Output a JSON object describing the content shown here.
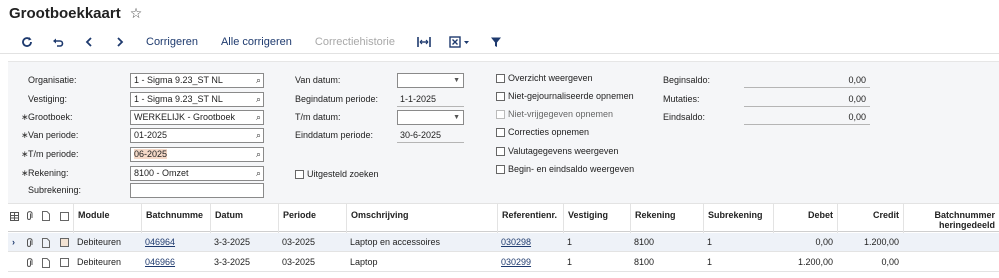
{
  "header": {
    "title": "Grootboekkaart",
    "star_icon": "star-icon"
  },
  "toolbar": {
    "corrigeren": "Corrigeren",
    "alle_corrigeren": "Alle corrigeren",
    "correctiehistorie": "Correctiehistorie"
  },
  "form": {
    "organisatie_label": "Organisatie:",
    "organisatie_value": "1 - Sigma 9.23_ST NL",
    "vestiging_label": "Vestiging:",
    "vestiging_value": "1 - Sigma 9.23_ST NL",
    "grootboek_label": "Grootboek:",
    "grootboek_value": "WERKELIJK - Grootboek",
    "van_periode_label": "Van periode:",
    "van_periode_value": "01-2025",
    "tm_periode_label": "T/m periode:",
    "tm_periode_value": "06-2025",
    "rekening_label": "Rekening:",
    "rekening_value": "8100 - Omzet",
    "subrekening_label": "Subrekening:",
    "subrekening_value": "",
    "van_datum_label": "Van datum:",
    "van_datum_value": "",
    "begindatum_label": "Begindatum periode:",
    "begindatum_value": "1-1-2025",
    "tm_datum_label": "T/m datum:",
    "tm_datum_value": "",
    "einddatum_label": "Einddatum periode:",
    "einddatum_value": "30-6-2025",
    "uitgesteld_label": "Uitgesteld zoeken",
    "checkboxes": [
      {
        "label": "Overzicht weergeven",
        "disabled": false
      },
      {
        "label": "Niet-gejournaliseerde opnemen",
        "disabled": false
      },
      {
        "label": "Niet-vrijgegeven opnemen",
        "disabled": true
      },
      {
        "label": "Correcties opnemen",
        "disabled": false
      },
      {
        "label": "Valutagegevens weergeven",
        "disabled": false
      },
      {
        "label": "Begin- en eindsaldo weergeven",
        "disabled": false
      }
    ],
    "beginsaldo_label": "Beginsaldo:",
    "beginsaldo_value": "0,00",
    "mutaties_label": "Mutaties:",
    "mutaties_value": "0,00",
    "eindsaldo_label": "Eindsaldo:",
    "eindsaldo_value": "0,00"
  },
  "grid": {
    "columns": {
      "module": "Module",
      "batchnummer": "Batchnumme",
      "datum": "Datum",
      "periode": "Periode",
      "omschrijving": "Omschrijving",
      "referentienr": "Referentienr.",
      "vestiging": "Vestiging",
      "rekening": "Rekening",
      "subrekening": "Subrekening",
      "debet": "Debet",
      "credit": "Credit",
      "batch_heringedeeld_1": "Batchnummer",
      "batch_heringedeeld_2": "heringedeeld"
    },
    "rows": [
      {
        "module": "Debiteuren",
        "batchnummer": "046964",
        "datum": "3-3-2025",
        "periode": "03-2025",
        "omschrijving": "Laptop en accessoires",
        "referentienr": "030298",
        "vestiging": "1",
        "rekening": "8100",
        "subrekening": "1",
        "debet": "0,00",
        "credit": "1.200,00"
      },
      {
        "module": "Debiteuren",
        "batchnummer": "046966",
        "datum": "3-3-2025",
        "periode": "03-2025",
        "omschrijving": "Laptop",
        "referentienr": "030299",
        "vestiging": "1",
        "rekening": "8100",
        "subrekening": "1",
        "debet": "1.200,00",
        "credit": "0,00"
      }
    ]
  }
}
